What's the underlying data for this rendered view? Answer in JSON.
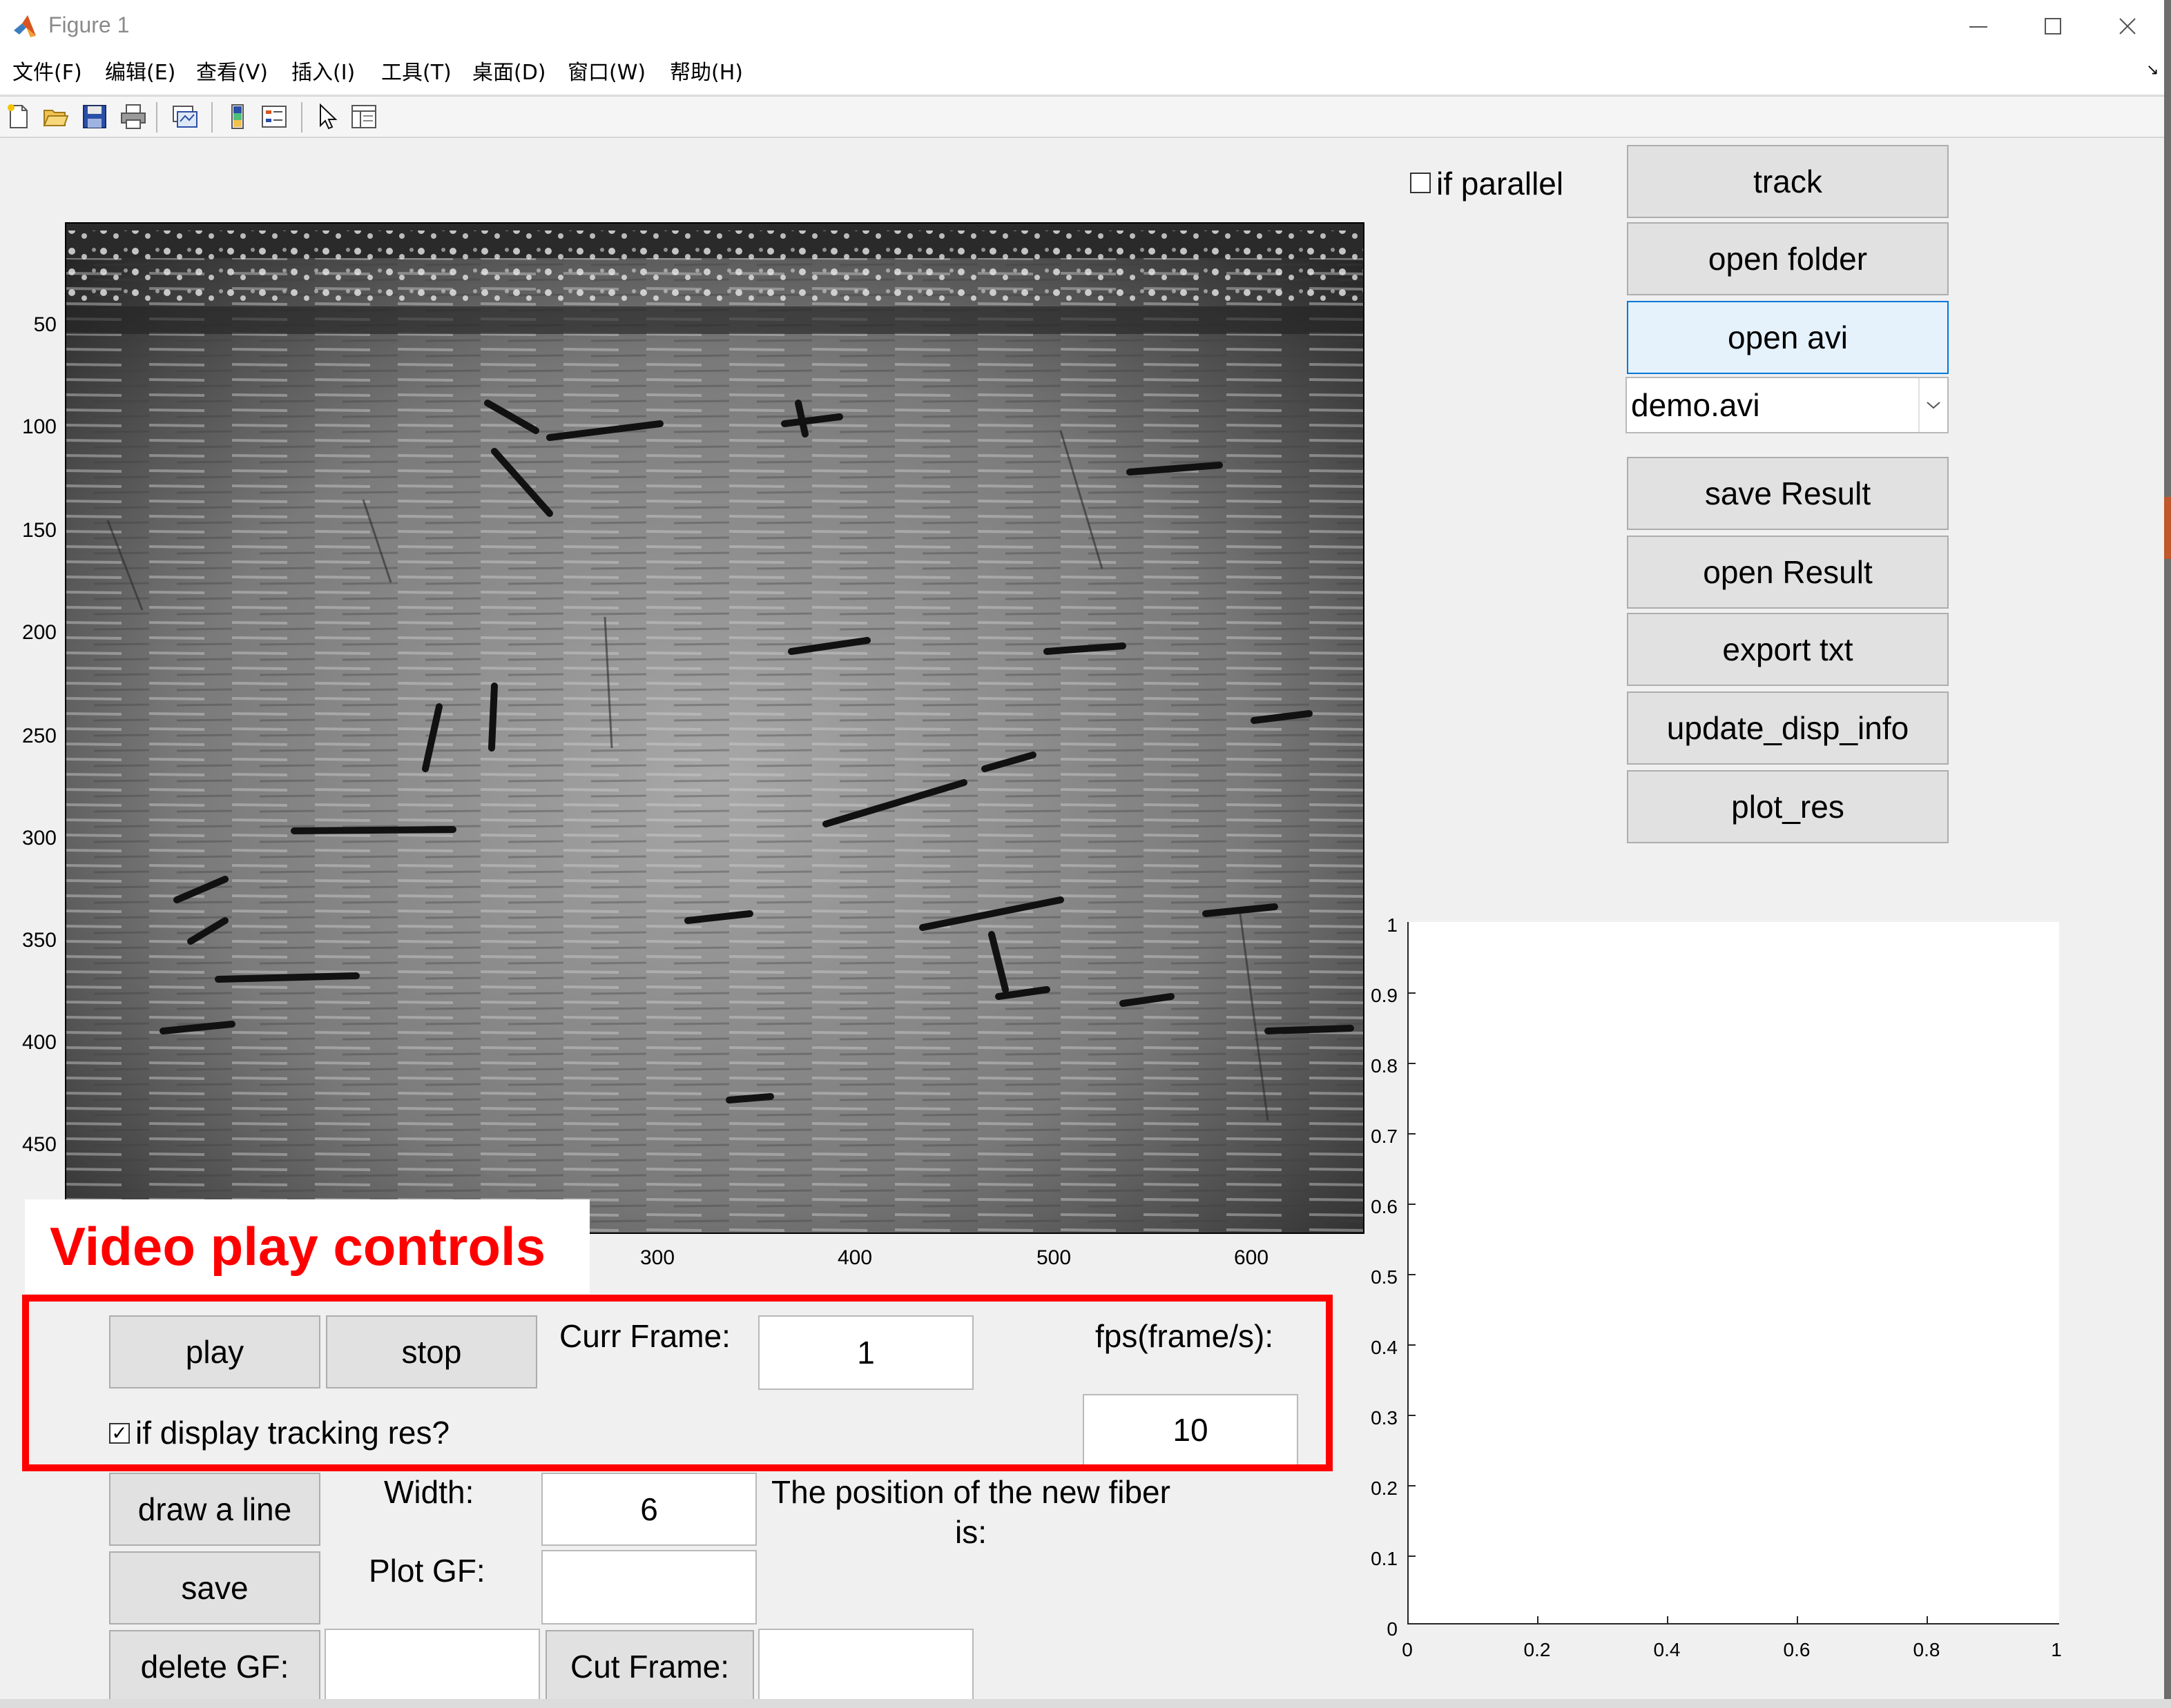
{
  "window": {
    "title": "Figure 1",
    "controls": {
      "minimize": "—",
      "maximize": "☐",
      "close": "✕"
    }
  },
  "menu": [
    "文件(F)",
    "编辑(E)",
    "查看(V)",
    "插入(I)",
    "工具(T)",
    "桌面(D)",
    "窗口(W)",
    "帮助(H)"
  ],
  "toolbar_icons": [
    "new-figure-icon",
    "open-file-icon",
    "save-icon",
    "print-icon",
    "link-plot-icon",
    "insert-colorbar-icon",
    "insert-legend-icon",
    "edit-plot-arrow-icon",
    "property-inspector-icon"
  ],
  "image_axes": {
    "y_ticks": [
      "50",
      "100",
      "150",
      "200",
      "250",
      "300",
      "350",
      "400",
      "450"
    ],
    "x_ticks": [
      "300",
      "400",
      "500",
      "600"
    ]
  },
  "annotation": {
    "label": "Video play controls",
    "color": "#ff0000"
  },
  "controls": {
    "parallel_checkbox": {
      "label": "if parallel",
      "checked": false
    },
    "right_buttons": {
      "track": "track",
      "open_folder": "open folder",
      "open_avi": "open avi",
      "save_result": "save Result",
      "open_result": "open Result",
      "export_txt": "export txt",
      "update_disp_info": "update_disp_info",
      "plot_res": "plot_res"
    },
    "file_select": {
      "value": "demo.avi"
    },
    "play": "play",
    "stop": "stop",
    "curr_frame_label": "Curr Frame:",
    "curr_frame_value": "1",
    "fps_label": "fps(frame/s):",
    "fps_value": "10",
    "display_tracking": {
      "label": "if display tracking res?",
      "checked": true
    },
    "draw_line": "draw a line",
    "width_label": "Width:",
    "width_value": "6",
    "position_text_1": "The position of the new fiber",
    "position_text_2": "is:",
    "save": "save",
    "plot_gf_label": "Plot GF:",
    "plot_gf_value": "",
    "delete_gf": "delete GF:",
    "delete_gf_value": "",
    "cut_frame": "Cut Frame:",
    "cut_frame_value": ""
  },
  "plot_axes": {
    "y_ticks": [
      "1",
      "0.9",
      "0.8",
      "0.7",
      "0.6",
      "0.5",
      "0.4",
      "0.3",
      "0.2",
      "0.1",
      "0"
    ],
    "x_ticks": [
      "0",
      "0.2",
      "0.4",
      "0.6",
      "0.8",
      "1"
    ]
  }
}
